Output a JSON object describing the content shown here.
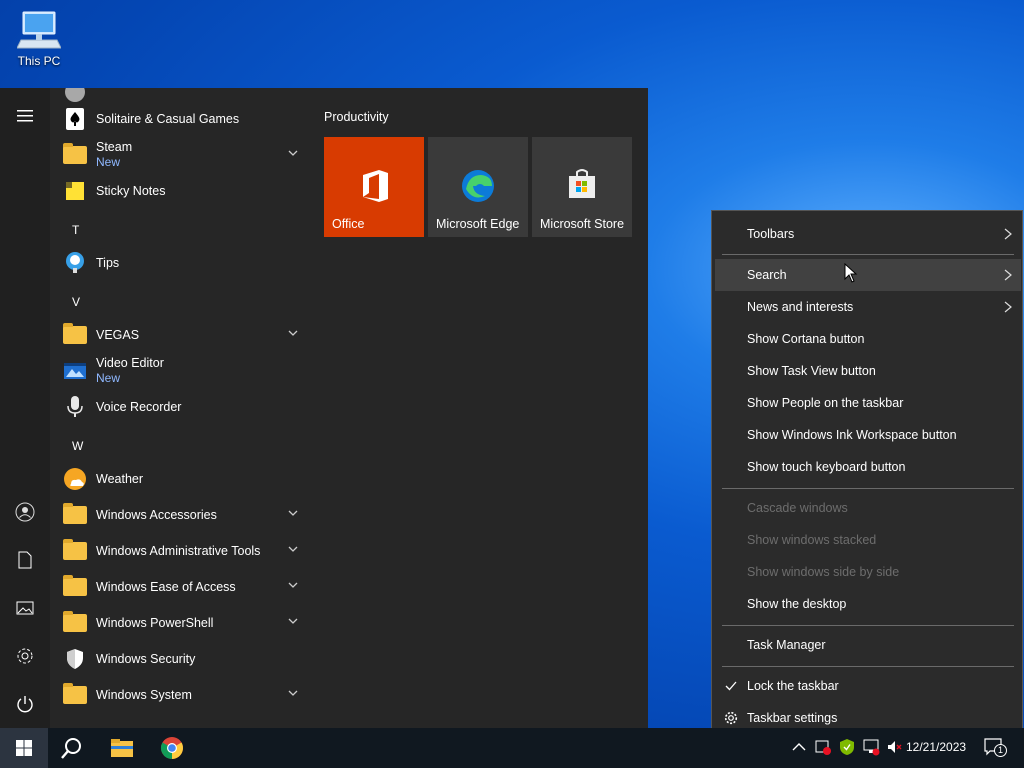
{
  "desktop": {
    "this_pc_label": "This PC"
  },
  "start_menu": {
    "app_list": [
      {
        "label": "Solitaire & Casual Games",
        "sub": "",
        "expandable": false,
        "icon": "solitaire-icon"
      },
      {
        "label": "Steam",
        "sub": "New",
        "expandable": true,
        "icon": "folder-icon"
      },
      {
        "label": "Sticky Notes",
        "sub": "",
        "expandable": false,
        "icon": "sticky-notes-icon"
      },
      {
        "label": "T",
        "type": "letter"
      },
      {
        "label": "Tips",
        "sub": "",
        "expandable": false,
        "icon": "tips-icon"
      },
      {
        "label": "V",
        "type": "letter"
      },
      {
        "label": "VEGAS",
        "sub": "",
        "expandable": true,
        "icon": "folder-icon"
      },
      {
        "label": "Video Editor",
        "sub": "New",
        "expandable": false,
        "icon": "video-editor-icon"
      },
      {
        "label": "Voice Recorder",
        "sub": "",
        "expandable": false,
        "icon": "voice-recorder-icon"
      },
      {
        "label": "W",
        "type": "letter"
      },
      {
        "label": "Weather",
        "sub": "",
        "expandable": false,
        "icon": "weather-icon"
      },
      {
        "label": "Windows Accessories",
        "sub": "",
        "expandable": true,
        "icon": "folder-icon"
      },
      {
        "label": "Windows Administrative Tools",
        "sub": "",
        "expandable": true,
        "icon": "folder-icon"
      },
      {
        "label": "Windows Ease of Access",
        "sub": "",
        "expandable": true,
        "icon": "folder-icon"
      },
      {
        "label": "Windows PowerShell",
        "sub": "",
        "expandable": true,
        "icon": "folder-icon"
      },
      {
        "label": "Windows Security",
        "sub": "",
        "expandable": false,
        "icon": "shield-icon"
      },
      {
        "label": "Windows System",
        "sub": "",
        "expandable": true,
        "icon": "folder-icon"
      }
    ],
    "tile_group_title": "Productivity",
    "tiles": [
      {
        "label": "Office",
        "color": "#d83b01",
        "icon": "office-icon"
      },
      {
        "label": "Microsoft Edge",
        "color": "#3a3a3a",
        "icon": "edge-icon"
      },
      {
        "label": "Microsoft Store",
        "color": "#3a3a3a",
        "icon": "store-icon"
      }
    ]
  },
  "context_menu": {
    "items": [
      {
        "label": "Toolbars",
        "submenu": true,
        "disabled": false,
        "highlighted": false
      },
      {
        "label": "Search",
        "submenu": true,
        "disabled": false,
        "highlighted": true
      },
      {
        "label": "News and interests",
        "submenu": true,
        "disabled": false,
        "highlighted": false
      },
      {
        "label": "Show Cortana button",
        "submenu": false,
        "disabled": false,
        "highlighted": false
      },
      {
        "label": "Show Task View button",
        "submenu": false,
        "disabled": false,
        "highlighted": false
      },
      {
        "label": "Show People on the taskbar",
        "submenu": false,
        "disabled": false,
        "highlighted": false
      },
      {
        "label": "Show Windows Ink Workspace button",
        "submenu": false,
        "disabled": false,
        "highlighted": false
      },
      {
        "label": "Show touch keyboard button",
        "submenu": false,
        "disabled": false,
        "highlighted": false
      },
      {
        "label": "Cascade windows",
        "submenu": false,
        "disabled": true,
        "highlighted": false
      },
      {
        "label": "Show windows stacked",
        "submenu": false,
        "disabled": true,
        "highlighted": false
      },
      {
        "label": "Show windows side by side",
        "submenu": false,
        "disabled": true,
        "highlighted": false
      },
      {
        "label": "Show the desktop",
        "submenu": false,
        "disabled": false,
        "highlighted": false
      },
      {
        "label": "Task Manager",
        "submenu": false,
        "disabled": false,
        "highlighted": false
      },
      {
        "label": "Lock the taskbar",
        "submenu": false,
        "disabled": false,
        "highlighted": false,
        "checked": true
      },
      {
        "label": "Taskbar settings",
        "submenu": false,
        "disabled": false,
        "highlighted": false,
        "icon": "gear-icon"
      }
    ]
  },
  "taskbar": {
    "date": "12/21/2023",
    "notification_count": "1",
    "pinned": [
      "start-icon",
      "search-icon",
      "file-explorer-icon",
      "chrome-icon"
    ]
  },
  "colors": {
    "accent": "#0078d7",
    "office_tile": "#d83b01",
    "start_bg": "#262626",
    "menu_bg": "#2b2b2b"
  }
}
